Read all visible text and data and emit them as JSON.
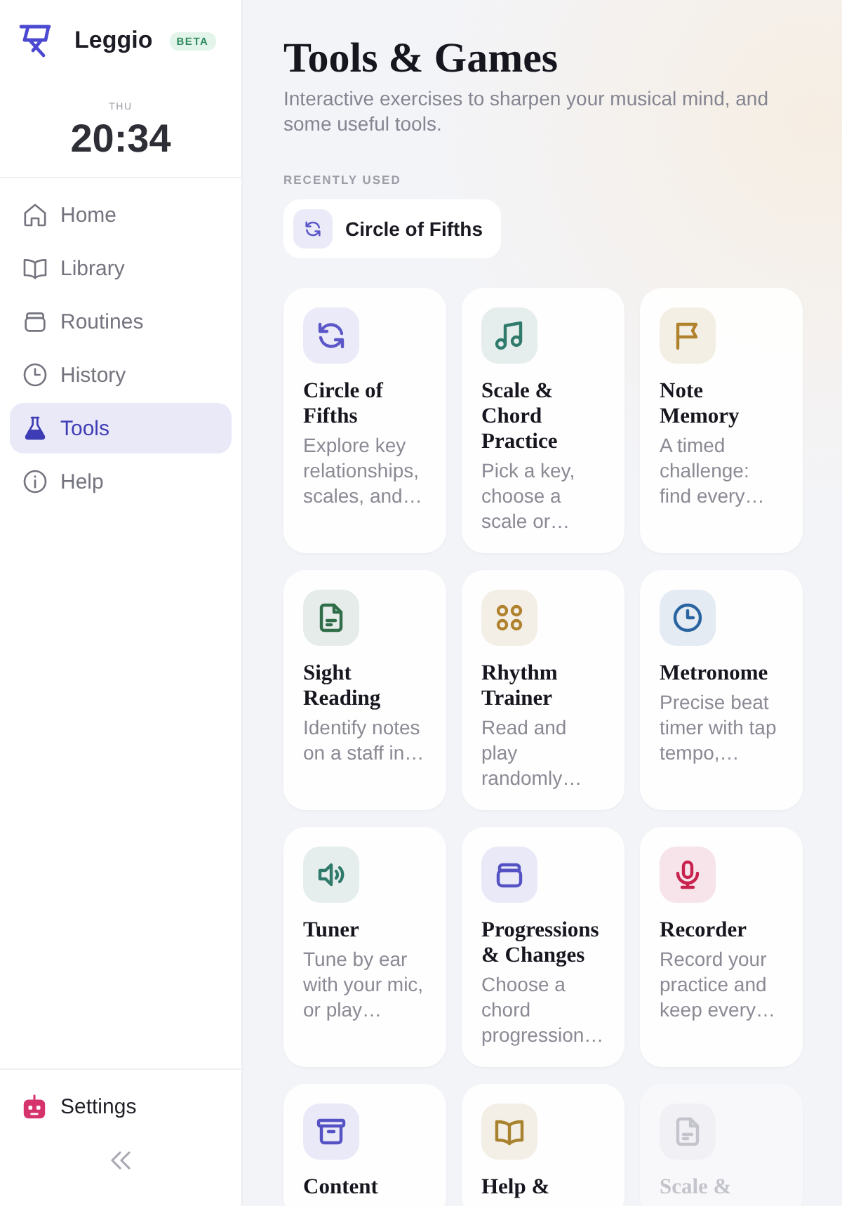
{
  "sidebar": {
    "brand": "Leggio",
    "badge": "BETA",
    "clock": {
      "day": "THU",
      "time": "20:34"
    },
    "items": [
      {
        "label": "Home",
        "selected": false
      },
      {
        "label": "Library",
        "selected": false
      },
      {
        "label": "Routines",
        "selected": false
      },
      {
        "label": "History",
        "selected": false
      },
      {
        "label": "Tools",
        "selected": true
      },
      {
        "label": "Help",
        "selected": false
      }
    ],
    "settings": {
      "label": "Settings"
    }
  },
  "header": {
    "title": "Tools & Games",
    "subtitle": "Interactive exercises to sharpen your musical mind, and some useful tools."
  },
  "recently_used": {
    "heading": "RECENTLY USED",
    "items": [
      {
        "label": "Circle of Fifths"
      }
    ]
  },
  "cards": [
    {
      "title": "Circle of Fifths",
      "description": "Explore key relationships, scales, and…",
      "color": "#5b57c8",
      "disabled": false
    },
    {
      "title": "Scale & Chord Practice",
      "description": "Pick a key, choose a scale or…",
      "color": "#2f7a6a",
      "disabled": false
    },
    {
      "title": "Note Memory",
      "description": "A timed challenge: find every…",
      "color": "#b0822e",
      "disabled": false
    },
    {
      "title": "Sight Reading",
      "description": "Identify notes on a staff in…",
      "color": "#2f6e48",
      "disabled": false
    },
    {
      "title": "Rhythm Trainer",
      "description": "Read and play randomly…",
      "color": "#b0822e",
      "disabled": false
    },
    {
      "title": "Metronome",
      "description": "Precise beat timer with tap tempo,…",
      "color": "#2a64a0",
      "disabled": false
    },
    {
      "title": "Tuner",
      "description": "Tune by ear with your mic, or play…",
      "color": "#2f7a6a",
      "disabled": false
    },
    {
      "title": "Progressions & Changes",
      "description": "Choose a chord progression…",
      "color": "#5552c4",
      "disabled": false
    },
    {
      "title": "Recorder",
      "description": "Record your practice and keep every…",
      "color": "#c8224f",
      "disabled": false
    },
    {
      "title": "Content",
      "color": "#5552c4",
      "disabled": false
    },
    {
      "title": "Help &",
      "color": "#a8822e",
      "disabled": false
    },
    {
      "title": "Scale &",
      "color": "#c4c4cc",
      "disabled": true
    }
  ]
}
